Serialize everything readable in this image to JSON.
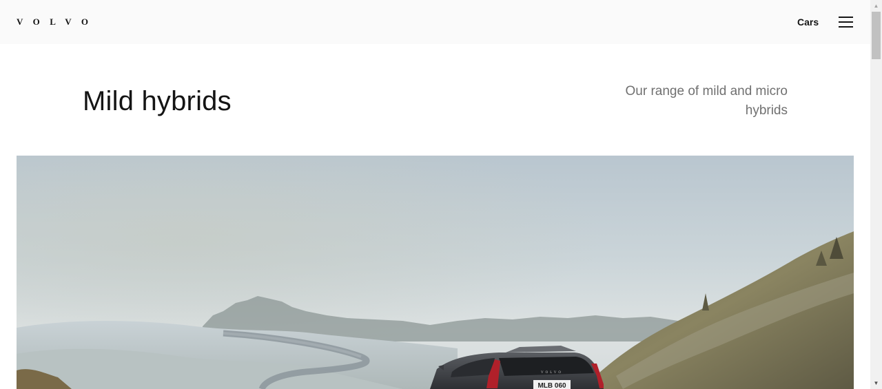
{
  "header": {
    "logo_text": "VOLVO",
    "nav_cars_label": "Cars",
    "menu_icon": "hamburger-menu-icon"
  },
  "main": {
    "title": "Mild hybrids",
    "subtitle": "Our range of mild and micro hybrids"
  },
  "hero": {
    "license_plate": "MLB 060",
    "car_badge": "VOLVO"
  },
  "scrollbar": {
    "up_arrow": "▲",
    "down_arrow": "▼"
  },
  "colors": {
    "header_bg": "#fafafa",
    "text_primary": "#141414",
    "text_secondary": "#707070",
    "sky": "#c3d0d8"
  }
}
